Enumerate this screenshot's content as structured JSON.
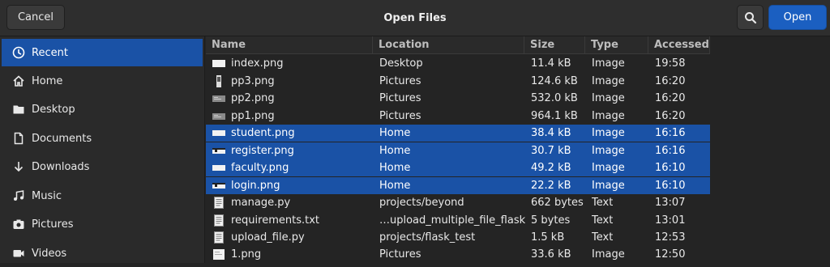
{
  "header": {
    "cancel_label": "Cancel",
    "title": "Open Files",
    "open_label": "Open"
  },
  "sidebar": {
    "items": [
      {
        "label": "Recent",
        "icon": "recent-icon",
        "selected": true
      },
      {
        "label": "Home",
        "icon": "home-icon",
        "selected": false
      },
      {
        "label": "Desktop",
        "icon": "desktop-icon",
        "selected": false
      },
      {
        "label": "Documents",
        "icon": "documents-icon",
        "selected": false
      },
      {
        "label": "Downloads",
        "icon": "downloads-icon",
        "selected": false
      },
      {
        "label": "Music",
        "icon": "music-icon",
        "selected": false
      },
      {
        "label": "Pictures",
        "icon": "pictures-icon",
        "selected": false
      },
      {
        "label": "Videos",
        "icon": "videos-icon",
        "selected": false
      }
    ]
  },
  "table": {
    "columns": [
      "Name",
      "Location",
      "Size",
      "Type",
      "Accessed"
    ],
    "rows": [
      {
        "name": "index.png",
        "location": "Desktop",
        "size": "11.4 kB",
        "type": "Image",
        "accessed": "19:58",
        "icon": "image-thumb-white-icon",
        "selected": false
      },
      {
        "name": "pp3.png",
        "location": "Pictures",
        "size": "124.6 kB",
        "type": "Image",
        "accessed": "16:20",
        "icon": "image-thumb-phone-icon",
        "selected": false
      },
      {
        "name": "pp2.png",
        "location": "Pictures",
        "size": "532.0 kB",
        "type": "Image",
        "accessed": "16:20",
        "icon": "image-thumb-gray-icon",
        "selected": false
      },
      {
        "name": "pp1.png",
        "location": "Pictures",
        "size": "964.1 kB",
        "type": "Image",
        "accessed": "16:20",
        "icon": "image-thumb-gray-icon",
        "selected": false
      },
      {
        "name": "student.png",
        "location": "Home",
        "size": "38.4 kB",
        "type": "Image",
        "accessed": "16:16",
        "icon": "image-thumb-white-icon",
        "selected": true
      },
      {
        "name": "register.png",
        "location": "Home",
        "size": "30.7 kB",
        "type": "Image",
        "accessed": "16:16",
        "icon": "image-thumb-bar-icon",
        "selected": true
      },
      {
        "name": "faculty.png",
        "location": "Home",
        "size": "49.2 kB",
        "type": "Image",
        "accessed": "16:10",
        "icon": "image-thumb-white-icon",
        "selected": true
      },
      {
        "name": "login.png",
        "location": "Home",
        "size": "22.2 kB",
        "type": "Image",
        "accessed": "16:10",
        "icon": "image-thumb-bar-icon",
        "selected": true
      },
      {
        "name": "manage.py",
        "location": "projects/beyond",
        "size": "662 bytes",
        "type": "Text",
        "accessed": "13:07",
        "icon": "text-file-icon",
        "selected": false
      },
      {
        "name": "requirements.txt",
        "location": "…upload_multiple_file_flask",
        "size": "5 bytes",
        "type": "Text",
        "accessed": "13:01",
        "icon": "text-file-icon",
        "selected": false
      },
      {
        "name": "upload_file.py",
        "location": "projects/flask_test",
        "size": "1.5 kB",
        "type": "Text",
        "accessed": "12:53",
        "icon": "text-file-icon",
        "selected": false
      },
      {
        "name": "1.png",
        "location": "Pictures",
        "size": "33.6 kB",
        "type": "Image",
        "accessed": "12:50",
        "icon": "image-thumb-white-icon",
        "selected": false
      }
    ]
  },
  "colors": {
    "accent": "#1a52a6",
    "open_button": "#1b5fc1"
  }
}
